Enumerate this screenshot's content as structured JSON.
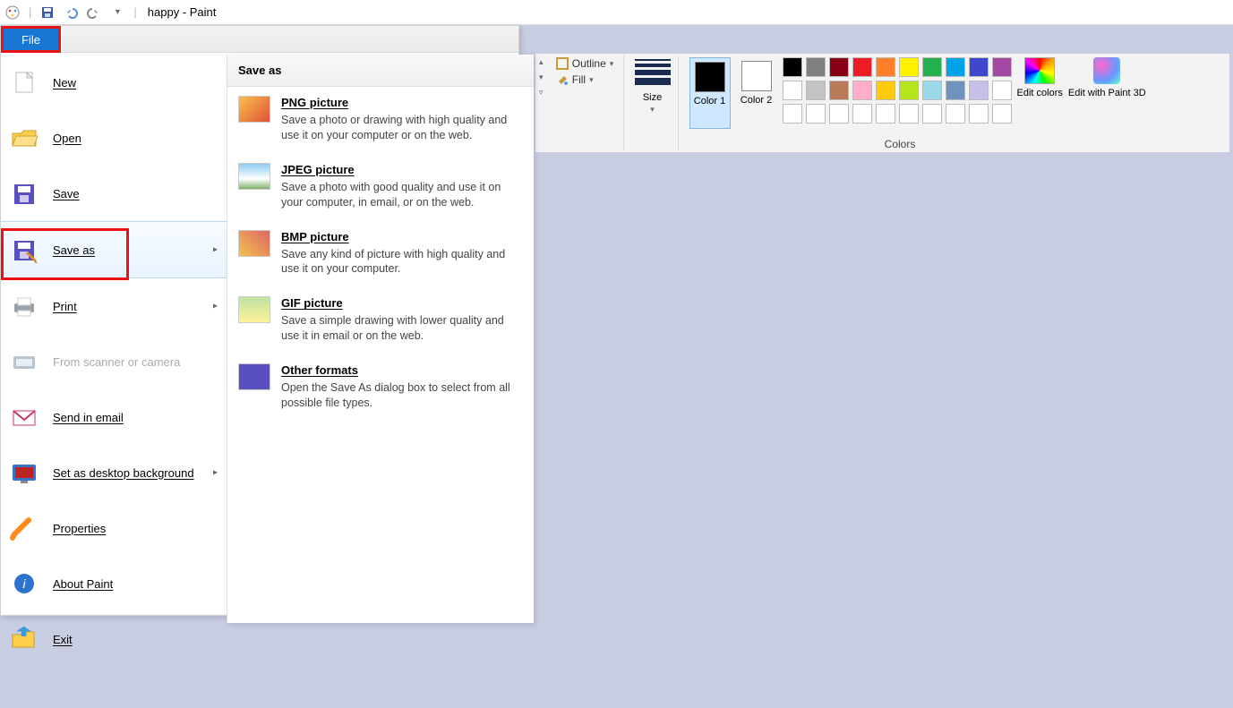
{
  "title": "happy - Paint",
  "file_tab_label": "File",
  "file_menu": [
    {
      "key": "new",
      "label": "New"
    },
    {
      "key": "open",
      "label": "Open"
    },
    {
      "key": "save",
      "label": "Save"
    },
    {
      "key": "save_as",
      "label": "Save as",
      "has_arrow": true,
      "highlighted": true
    },
    {
      "key": "print",
      "label": "Print",
      "has_arrow": true
    },
    {
      "key": "scanner",
      "label": "From scanner or camera",
      "disabled": true
    },
    {
      "key": "email",
      "label": "Send in email"
    },
    {
      "key": "wallpaper",
      "label": "Set as desktop background",
      "has_arrow": true
    },
    {
      "key": "properties",
      "label": "Properties"
    },
    {
      "key": "about",
      "label": "About Paint"
    },
    {
      "key": "exit",
      "label": "Exit"
    }
  ],
  "submenu": {
    "title": "Save as",
    "items": [
      {
        "key": "png",
        "name": "PNG picture",
        "desc": "Save a photo or drawing with high quality and use it on your computer or on the web."
      },
      {
        "key": "jpeg",
        "name": "JPEG picture",
        "desc": "Save a photo with good quality and use it on your computer, in email, or on the web."
      },
      {
        "key": "bmp",
        "name": "BMP picture",
        "desc": "Save any kind of picture with high quality and use it on your computer."
      },
      {
        "key": "gif",
        "name": "GIF picture",
        "desc": "Save a simple drawing with lower quality and use it in email or on the web."
      },
      {
        "key": "other",
        "name": "Other formats",
        "desc": "Open the Save As dialog box to select from all possible file types."
      }
    ]
  },
  "ribbon": {
    "outline_label": "Outline",
    "fill_label": "Fill",
    "size_label": "Size",
    "color1_label": "Color 1",
    "color2_label": "Color 2",
    "color1_value": "#000000",
    "color2_value": "#ffffff",
    "edit_colors_label": "Edit colors",
    "paint3d_label": "Edit with Paint 3D",
    "colors_group_label": "Colors",
    "palette_rows": [
      [
        "#000000",
        "#7f7f7f",
        "#880015",
        "#ed1c24",
        "#ff7f27",
        "#fff200",
        "#22b14c",
        "#00a2e8",
        "#3f48cc",
        "#a349a4"
      ],
      [
        "#ffffff",
        "#c3c3c3",
        "#b97a57",
        "#ffaec9",
        "#ffc90e",
        "#b5e61d",
        "#99d9ea",
        "#7092be",
        "#c8bfe7",
        "#ffffff"
      ],
      [
        "#ffffff",
        "#ffffff",
        "#ffffff",
        "#ffffff",
        "#ffffff",
        "#ffffff",
        "#ffffff",
        "#ffffff",
        "#ffffff",
        "#ffffff"
      ]
    ]
  }
}
